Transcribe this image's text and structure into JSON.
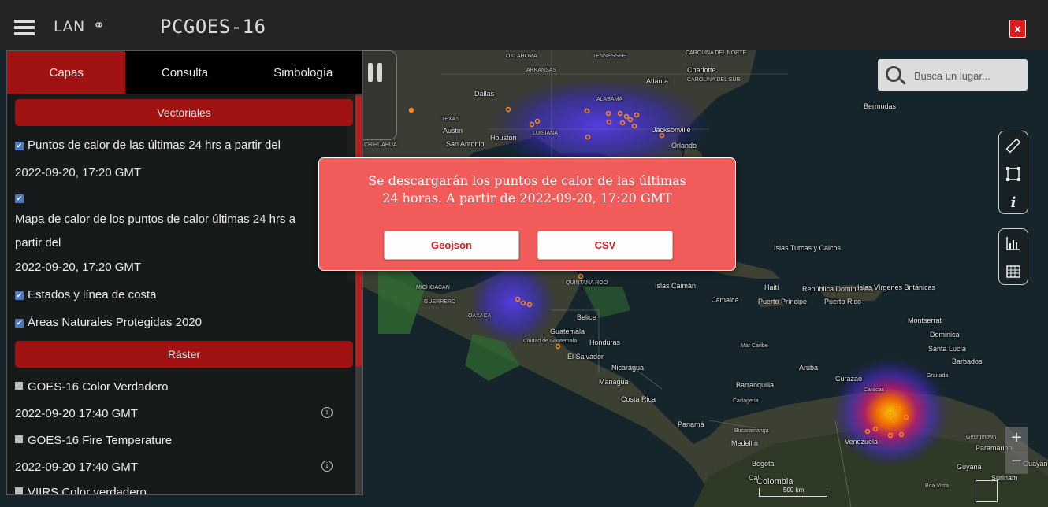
{
  "app": {
    "logo_text": "LAN",
    "title": "PCGOES-16",
    "close_label": "x"
  },
  "panel": {
    "tabs": [
      {
        "label": "Capas",
        "active": true
      },
      {
        "label": "Consulta",
        "active": false
      },
      {
        "label": "Simbología",
        "active": false
      }
    ],
    "sections": {
      "vector": "Vectoriales",
      "raster": "Ráster"
    },
    "vector_layers": [
      {
        "label": "Puntos de calor de las últimas 24 hrs a partir del",
        "checked": true
      },
      {
        "date": "2022-09-20, 17:20 GMT"
      },
      {
        "label": "",
        "checked": true
      },
      {
        "label": "Mapa de calor de los puntos de calor últimas 24 hrs a partir del"
      },
      {
        "label_cont": "partir del"
      },
      {
        "date": "2022-09-20, 17:20 GMT"
      },
      {
        "label": "Estados y línea de costa",
        "checked": true
      },
      {
        "label": "Áreas Naturales Protegidas 2020",
        "checked": true
      }
    ],
    "row_texts": {
      "r1": "Puntos de calor de las últimas 24 hrs a partir del",
      "r2": "2022-09-20, 17:20 GMT",
      "r4": "Mapa de calor de los puntos de calor últimas 24 hrs a",
      "r5": "partir del",
      "r6": "2022-09-20, 17:20 GMT",
      "r7": "Estados y línea de costa",
      "r8": "Áreas Naturales Protegidas 2020",
      "r9": "GOES-16 Color Verdadero",
      "r10": "2022-09-20 17:40 GMT",
      "r11": "GOES-16 Fire Temperature",
      "r12": "2022-09-20 17:40 GMT",
      "r13": "VIIRS Color verdadero"
    }
  },
  "search": {
    "placeholder": "Busca un lugar..."
  },
  "zoom": {
    "in": "+",
    "out": "−"
  },
  "scale": {
    "label": "500 km"
  },
  "modal": {
    "line1": "Se descargarán los puntos de calor de las últimas",
    "line2": "24 horas. A partir de 2022-09-20, 17:20 GMT",
    "geojson_label": "Geojson",
    "csv_label": "CSV"
  },
  "map_labels": {
    "oklahoma": "OKLAHOMA",
    "tennessee": "TENNESSEE",
    "carolina_norte": "CAROLINA DEL NORTE",
    "arkansas": "ARKANSAS",
    "charlotte": "Charlotte",
    "atlanta": "Atlanta",
    "carolina_sur": "CAROLINA DEL SUR",
    "dallas": "Dallas",
    "alabama": "ALABAMA",
    "texas": "TEXAS",
    "austin": "Austin",
    "houston": "Houston",
    "louisiana": "LUISIANA",
    "jacksonville": "Jacksonville",
    "san_antonio": "San Antonio",
    "orlando": "Orlando",
    "bermudas": "Bermudas",
    "chihuahua": "CHIHUAHUA",
    "islas_turcas": "Islas Turcas y Caicos",
    "islas_caiman": "Islas Caimán",
    "haiti": "Haití",
    "rep_dominicana": "República Dominicana",
    "islas_virgenes": "Islas Vírgenes Británicas",
    "jamaica": "Jamaica",
    "puerto_principe": "Puerto Príncipe",
    "puerto_rico": "Puerto Rico",
    "belice": "Belice",
    "guatemala": "Guatemala",
    "ciudad_guatemala": "Ciudad de Guatemala",
    "honduras": "Honduras",
    "el_salvador": "El Salvador",
    "nicaragua": "Nicaragua",
    "managua": "Managua",
    "costa_rica": "Costa Rica",
    "panama": "Panamá",
    "mar_caribe": "Mar Caribe",
    "aruba": "Aruba",
    "curazao": "Curazao",
    "barranquilla": "Barranquilla",
    "cartagena": "Cartagena",
    "caracas": "Caracas",
    "venezuela": "Venezuela",
    "medellin": "Medellín",
    "bogota": "Bogotá",
    "cali": "Cali",
    "colombia": "Colombia",
    "bucaramanga": "Bucaramanga",
    "montserrat": "Montserrat",
    "dominica": "Dominica",
    "santa_lucia": "Santa Lucía",
    "barbados": "Barbados",
    "granada": "Granada",
    "georgetown": "Georgetown",
    "paramaribo": "Paramaribo",
    "guyana": "Guyana",
    "surinam": "Surinam",
    "guayana_francesa": "Guayana Francesa",
    "oaxaca": "OAXACA",
    "guerrero": "GUERRERO",
    "michoacan": "MICHOACÁN",
    "quintana_roo": "QUINTANA ROO",
    "boa_vista": "Boa Vista"
  }
}
